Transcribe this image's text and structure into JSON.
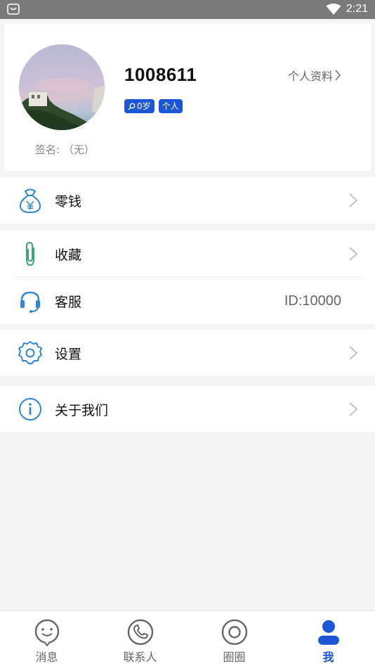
{
  "status_bar": {
    "time": "2:21"
  },
  "profile": {
    "username": "1008611",
    "badge_age": "0岁",
    "badge_type": "个人",
    "profile_link": "个人资料",
    "signature": "签名: （无）"
  },
  "menu": {
    "wallet": "零钱",
    "favorites": "收藏",
    "service": "客服",
    "service_id": "ID:10000",
    "settings": "设置",
    "about": "关于我们"
  },
  "nav": {
    "messages": "消息",
    "contacts": "联系人",
    "moments": "圈圈",
    "me": "我"
  },
  "colors": {
    "accent": "#1a56d6",
    "icon_blue": "#2f86d6",
    "icon_green": "#3aa86b"
  }
}
